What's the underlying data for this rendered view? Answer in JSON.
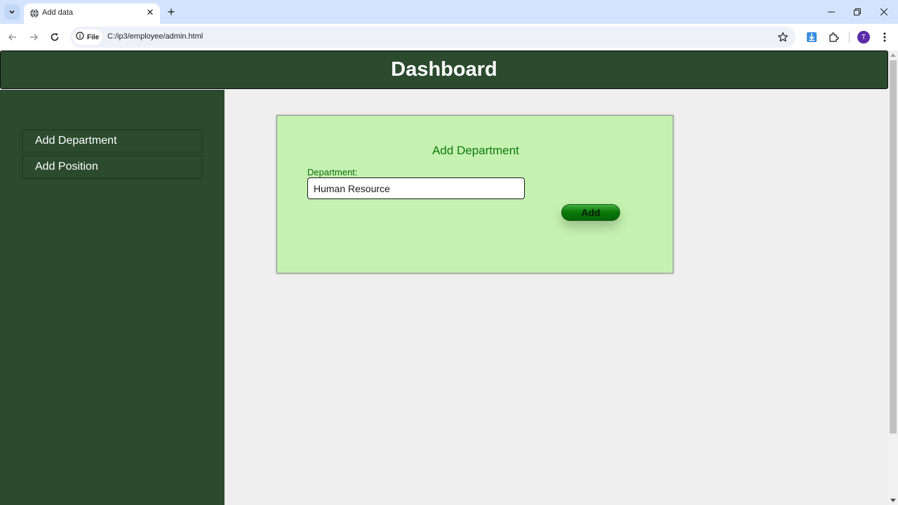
{
  "browser": {
    "tab_title": "Add data",
    "file_chip_label": "File",
    "url": "C:/ip3/employee/admin.html",
    "profile_initial": "T"
  },
  "page": {
    "header_title": "Dashboard",
    "sidebar": {
      "items": [
        {
          "label": "Add Department"
        },
        {
          "label": "Add Position"
        }
      ]
    },
    "form": {
      "title": "Add Department",
      "field_label": "Department:",
      "field_value": "Human Resource",
      "submit_label": "Add"
    }
  },
  "colors": {
    "dark_green": "#2b4a2e",
    "card_background": "#c5f2b0",
    "accent_green": "#0d7a0d"
  },
  "icons": [
    "tab-list-icon",
    "globe-icon",
    "close-icon",
    "plus-icon",
    "minimize-icon",
    "restore-icon",
    "back-arrow-icon",
    "forward-arrow-icon",
    "reload-icon",
    "info-icon",
    "star-icon",
    "download-icon",
    "extensions-icon",
    "more-vert-icon"
  ]
}
